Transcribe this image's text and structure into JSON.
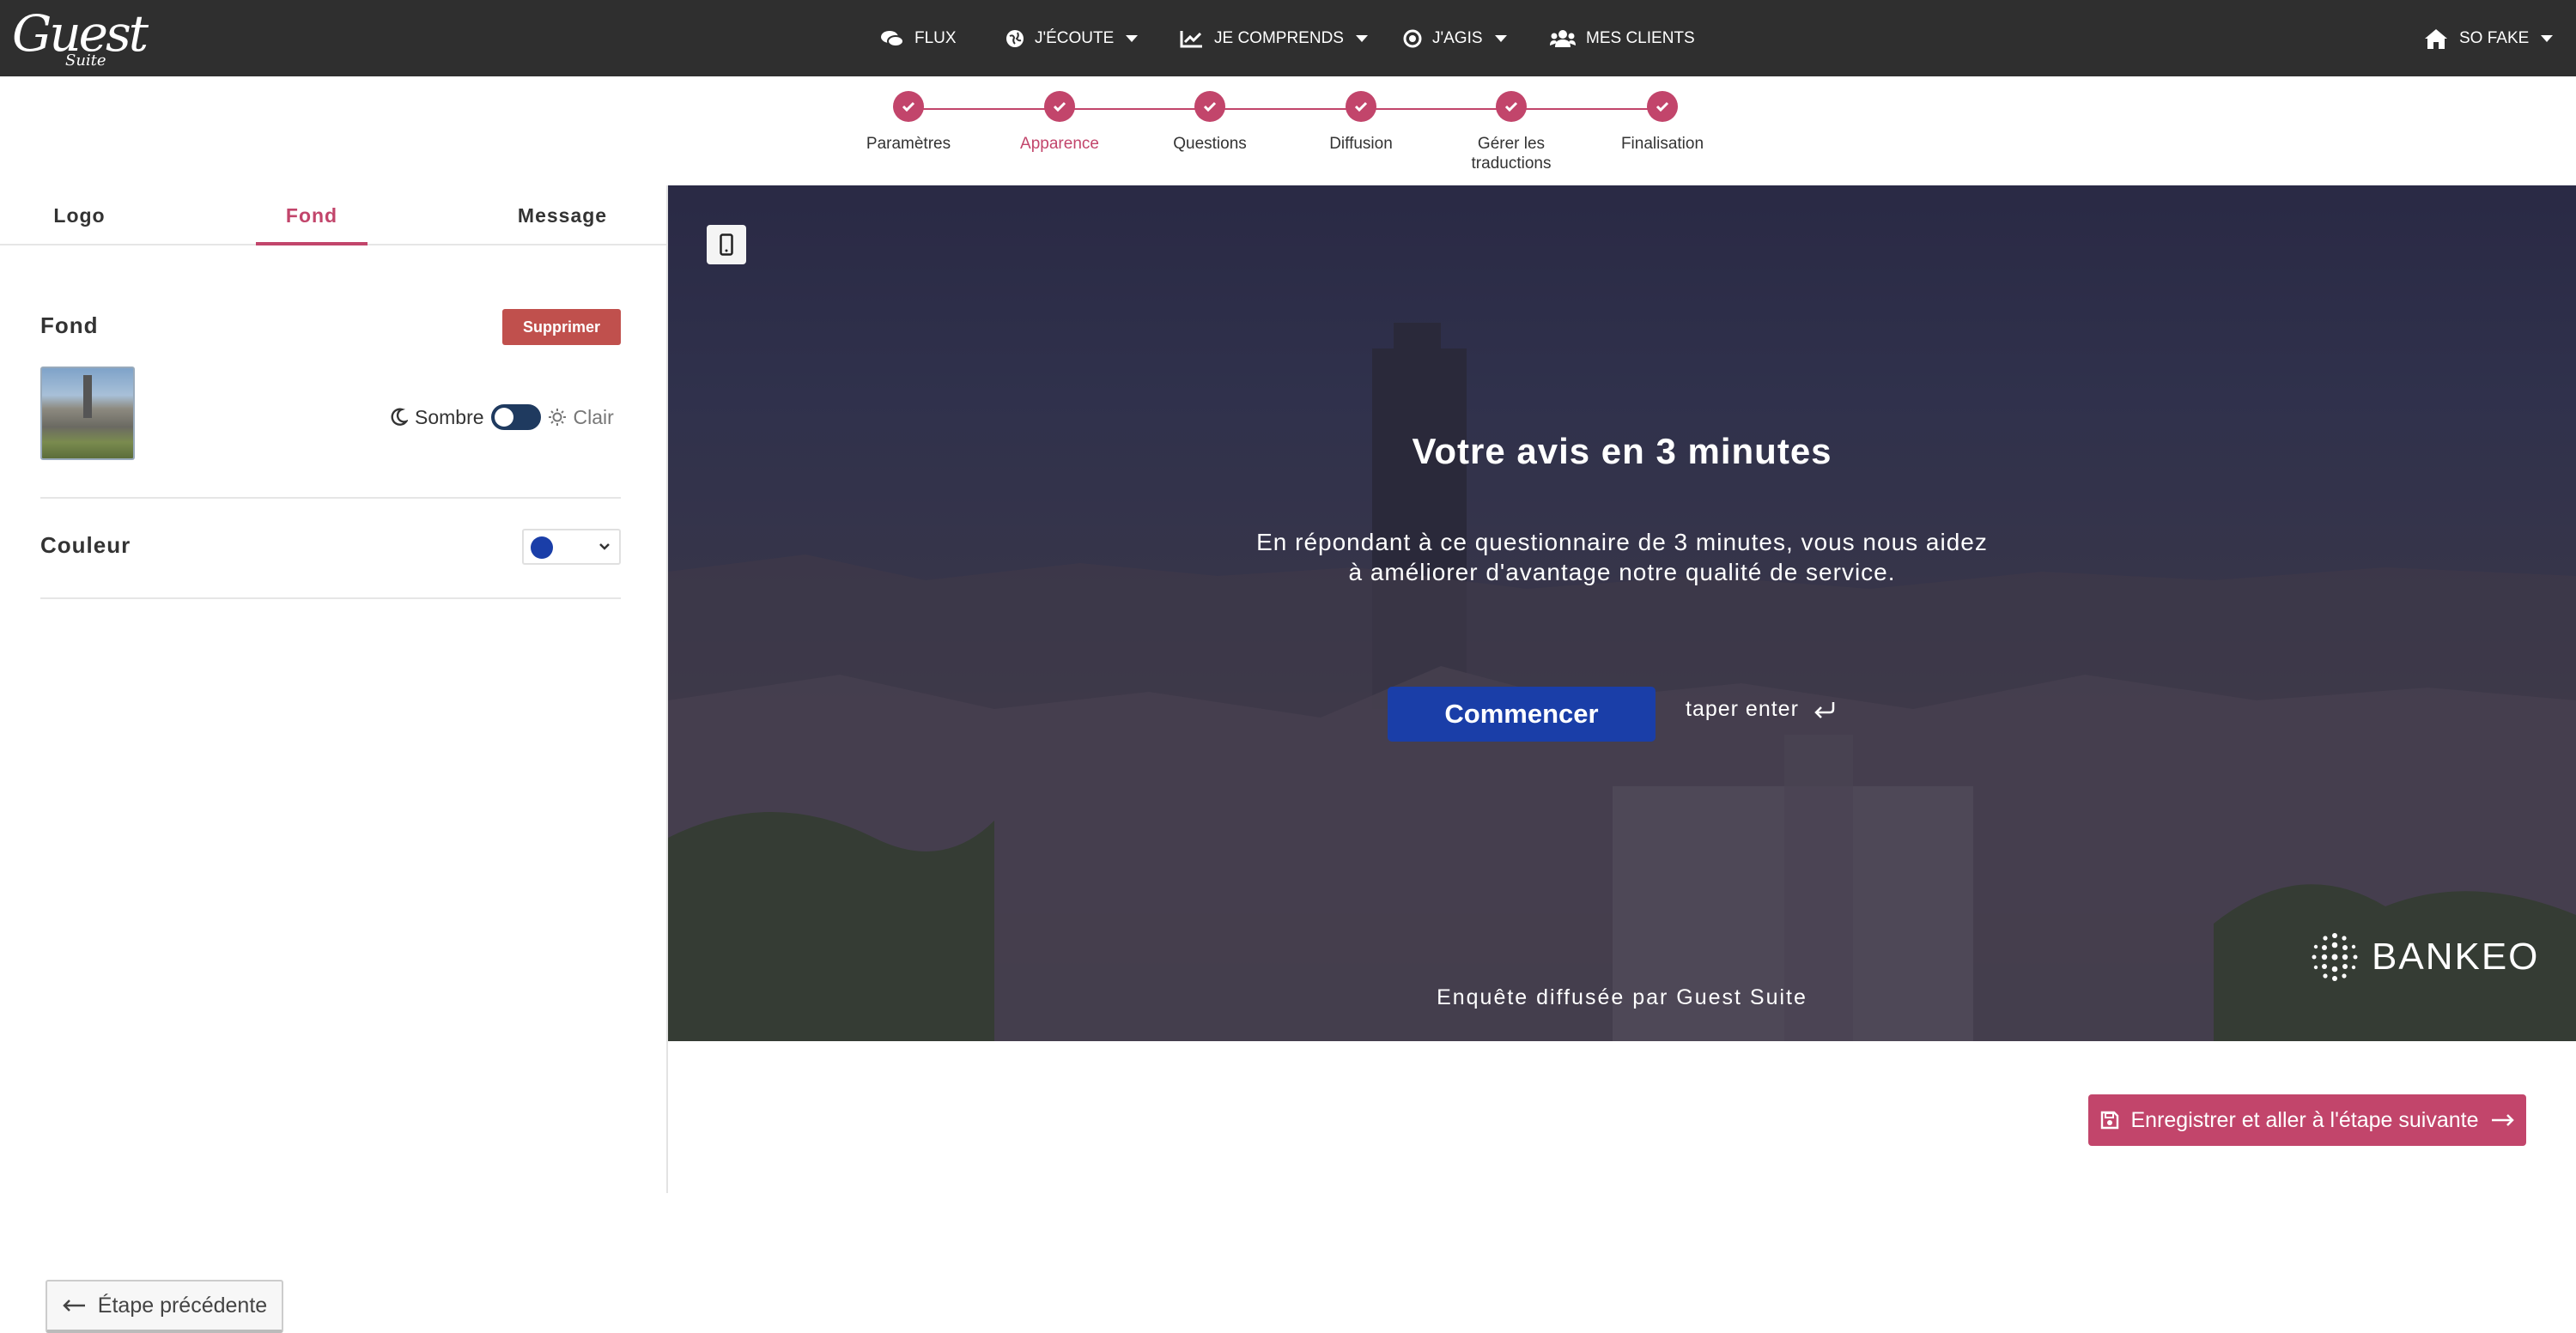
{
  "app": {
    "logo_main": "Guest",
    "logo_sub": "Suite"
  },
  "nav": {
    "flux": "FLUX",
    "jecoute": "J'ÉCOUTE",
    "jecomprends": "JE COMPRENDS",
    "jagis": "J'AGIS",
    "clients": "MES CLIENTS",
    "account": "SO FAKE"
  },
  "steps": [
    {
      "label": "Paramètres"
    },
    {
      "label": "Apparence"
    },
    {
      "label": "Questions"
    },
    {
      "label": "Diffusion"
    },
    {
      "label": "Gérer les traductions"
    },
    {
      "label": "Finalisation"
    }
  ],
  "active_step": "Apparence",
  "tabs": {
    "logo": "Logo",
    "fond": "Fond",
    "message": "Message",
    "active": "Fond"
  },
  "fond": {
    "title": "Fond",
    "delete_label": "Supprimer",
    "dark_label": "Sombre",
    "light_label": "Clair",
    "mode": "Sombre"
  },
  "couleur": {
    "title": "Couleur",
    "value": "#1a3ea8"
  },
  "preview": {
    "title": "Votre avis en 3 minutes",
    "subtitle": "En répondant à ce questionnaire de 3 minutes, vous nous aidez à améliorer d'avantage notre qualité de service.",
    "start_label": "Commencer",
    "enter_hint": "taper enter",
    "brand": "BANKEO",
    "credit": "Enquête diffusée par Guest Suite"
  },
  "footer": {
    "prev_label": "Étape précédente",
    "next_label": "Enregistrer et aller à l'étape suivante"
  },
  "colors": {
    "accent": "#c2456b",
    "topbar": "#2f2f2f",
    "danger": "#c0504d",
    "primary": "#1a3ea8"
  },
  "icons": [
    "chat-icon",
    "globe-icon",
    "chart-icon",
    "target-icon",
    "users-icon",
    "home-icon",
    "check-icon",
    "mobile-icon",
    "moon-icon",
    "sun-icon",
    "arrow-left-icon",
    "save-icon",
    "arrow-right-icon",
    "enter-icon"
  ]
}
